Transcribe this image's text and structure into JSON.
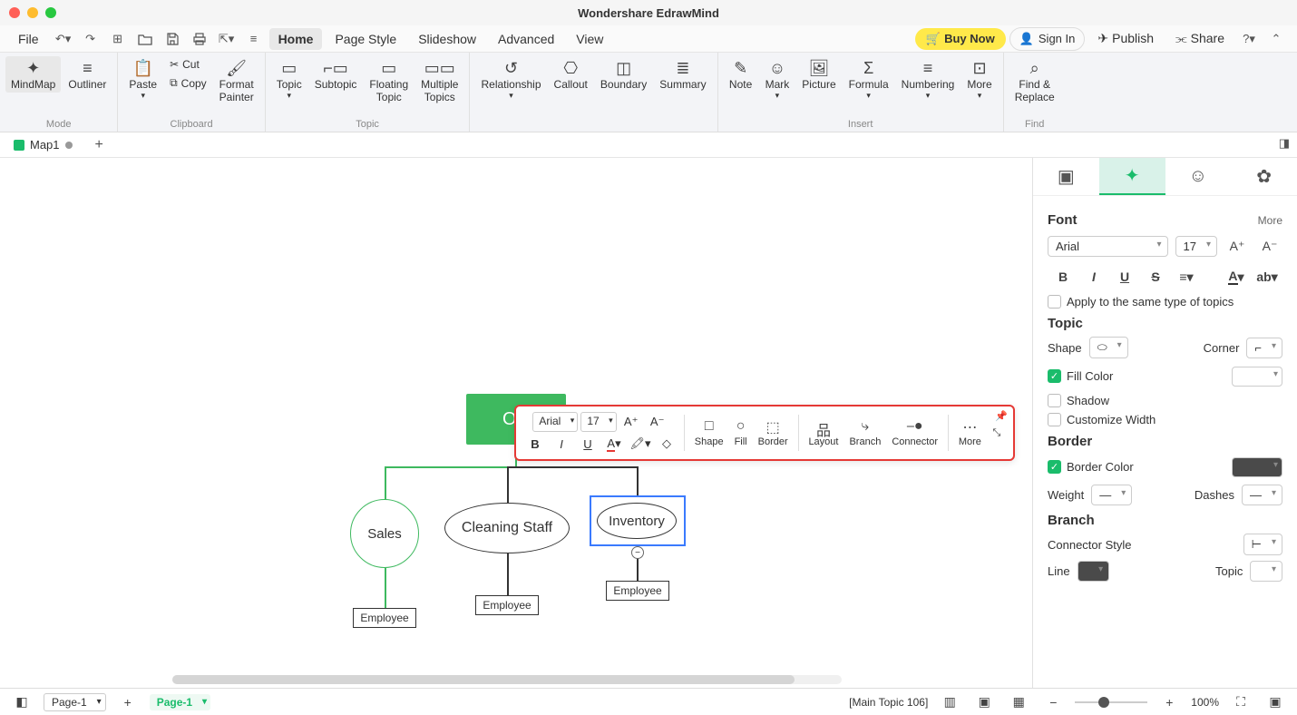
{
  "app_title": "Wondershare EdrawMind",
  "menubar": {
    "file": "File",
    "home": "Home",
    "page_style": "Page Style",
    "slideshow": "Slideshow",
    "advanced": "Advanced",
    "view": "View",
    "buy_now": "Buy Now",
    "sign_in": "Sign In",
    "publish": "Publish",
    "share": "Share"
  },
  "ribbon": {
    "mode": {
      "mindmap": "MindMap",
      "outliner": "Outliner",
      "label": "Mode"
    },
    "clipboard": {
      "paste": "Paste",
      "cut": "Cut",
      "copy": "Copy",
      "format_painter": "Format\nPainter",
      "label": "Clipboard"
    },
    "topic": {
      "topic": "Topic",
      "subtopic": "Subtopic",
      "floating": "Floating\nTopic",
      "multiple": "Multiple\nTopics",
      "label": "Topic"
    },
    "group3": {
      "relationship": "Relationship",
      "callout": "Callout",
      "boundary": "Boundary",
      "summary": "Summary"
    },
    "insert": {
      "note": "Note",
      "mark": "Mark",
      "picture": "Picture",
      "formula": "Formula",
      "numbering": "Numbering",
      "more": "More",
      "label": "Insert"
    },
    "find": {
      "find_replace": "Find &\nReplace",
      "label": "Find"
    }
  },
  "doc_tab": "Map1",
  "canvas": {
    "owner": "Ow",
    "sales": "Sales",
    "cleaning": "Cleaning Staff",
    "inventory": "Inventory",
    "employee": "Employee"
  },
  "floatbar": {
    "font": "Arial",
    "size": "17",
    "increase": "A⁺",
    "decrease": "A⁻",
    "tools": [
      "Shape",
      "Fill",
      "Border",
      "Layout",
      "Branch",
      "Connector",
      "More"
    ]
  },
  "side": {
    "font": {
      "title": "Font",
      "more": "More",
      "family": "Arial",
      "size": "17",
      "apply": "Apply to the same type of topics"
    },
    "topic": {
      "title": "Topic",
      "shape": "Shape",
      "corner": "Corner",
      "fill": "Fill Color",
      "shadow": "Shadow",
      "custom": "Customize Width"
    },
    "border": {
      "title": "Border",
      "color": "Border Color",
      "weight": "Weight",
      "dashes": "Dashes"
    },
    "branch": {
      "title": "Branch",
      "connector": "Connector Style",
      "line": "Line",
      "topic": "Topic"
    }
  },
  "status": {
    "page_sel": "Page-1",
    "page_tab": "Page-1",
    "info": "[Main Topic 106]",
    "zoom": "100%"
  }
}
